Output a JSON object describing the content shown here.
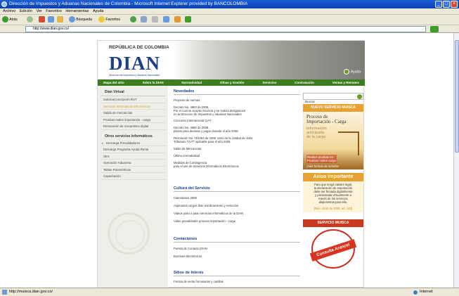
{
  "browser": {
    "title": "Dirección de Impuestos y Aduanas Nacionales de Colombia - Microsoft Internet Explorer provided by BANCOLOMBIA",
    "menu": [
      "Archivo",
      "Edición",
      "Ver",
      "Favoritos",
      "Herramientas",
      "Ayuda"
    ],
    "toolbar": {
      "back": "Atrás",
      "search": "Búsqueda",
      "favorites": "Favoritos"
    },
    "address": "http://www.dian.gov.co/",
    "status_url": "http://muisca.dian.gov.co/",
    "zone": "Internet"
  },
  "site": {
    "country": "REPÚBLICA DE COLOMBIA",
    "logo": "DIAN",
    "logo_sub": "Dirección de Impuestos y Aduanas Nacionales",
    "help": "Ayuda",
    "nav": [
      "Mapa del sitio",
      "Sobre la DIAN",
      "Normatividad",
      "Ofnas y Gestión",
      "Servicios",
      "Contratación",
      "Ventas y Remates"
    ],
    "sidebar": {
      "header": "Dian Virtual",
      "items": [
        "Solicitud inscripción RUT",
        "Servicios Informáticos Electrónicos",
        "Salida de mercancías",
        "Pruebas reales importación - carga",
        "Renovación de mecanismo digital"
      ],
      "header2": "Otros servicios informáticos",
      "items2": [
        "Descarga Prevalidadores",
        "Descarga Programa Ayuda Renta",
        "SEX",
        "Operación Aduanera",
        "Tablas Paramétricas",
        "Capacitación"
      ]
    },
    "main": {
      "novedades": "Novedades",
      "news": [
        "Proyecto de normas",
        "Decreto No. 4863 de 2008,\nPor el cual se acepta renuncia y se realiza designacion\nen la Direccion de Impuestos y Aduanas Nacionales",
        "Concurso Internacional CIAT",
        "Decreto No. 4680 de 2008 ,\nplazos para declarar y pagar durante el año 2009.",
        "Resolución No. 001063 de 2008, valor de la Unidad de Valor\nTributario \"UVT\" aplicable para el año 2009.",
        "Saldo de Mercancías",
        "Última normatividad",
        "Medidas de Contingencia\npara el uso de Servicios Informáticos Electrónicos"
      ],
      "cultura": "Cultura del Servicio",
      "cultura_items": [
        "Calendarios 2009",
        "Aspirantes cargos libre nombramiento y remoción",
        "Videos paso a paso servicios informáticos de la DIAN",
        "Video prevalidador proceso importación - carga"
      ],
      "contactenos": "Contáctenos",
      "contact_items": [
        "Puntos de Contacto DIAN",
        "Buzones Electrónicos"
      ],
      "sitios": "Sitios de Interés",
      "sitios_items": [
        "Puntos de venta formularios y cartillas"
      ]
    },
    "right": {
      "search_value": "Buscar",
      "nuevo": "NUEVO SERVICIO MUISCA",
      "proceso": "Proceso de\nImportación - Carga",
      "info": "Información\nanticipada\nde la carga",
      "realice": "Realice pruebas en\nPruebas reales carga",
      "mas": "¡más formas de servirle!",
      "aviso": "Aviso importante",
      "aviso_text": "Para que tenga validez legal,\nla declaración de exportación\ndebe ser firmada digitalmente\ny presentada virtualmente a\ntravés de los servicios\ndisponestos para ello.",
      "aviso_res": "(Res. 4240 de 2000, art. 243)",
      "servicio": "SERVICIO MUISCA",
      "stamp": "Consulta Arancel"
    }
  }
}
